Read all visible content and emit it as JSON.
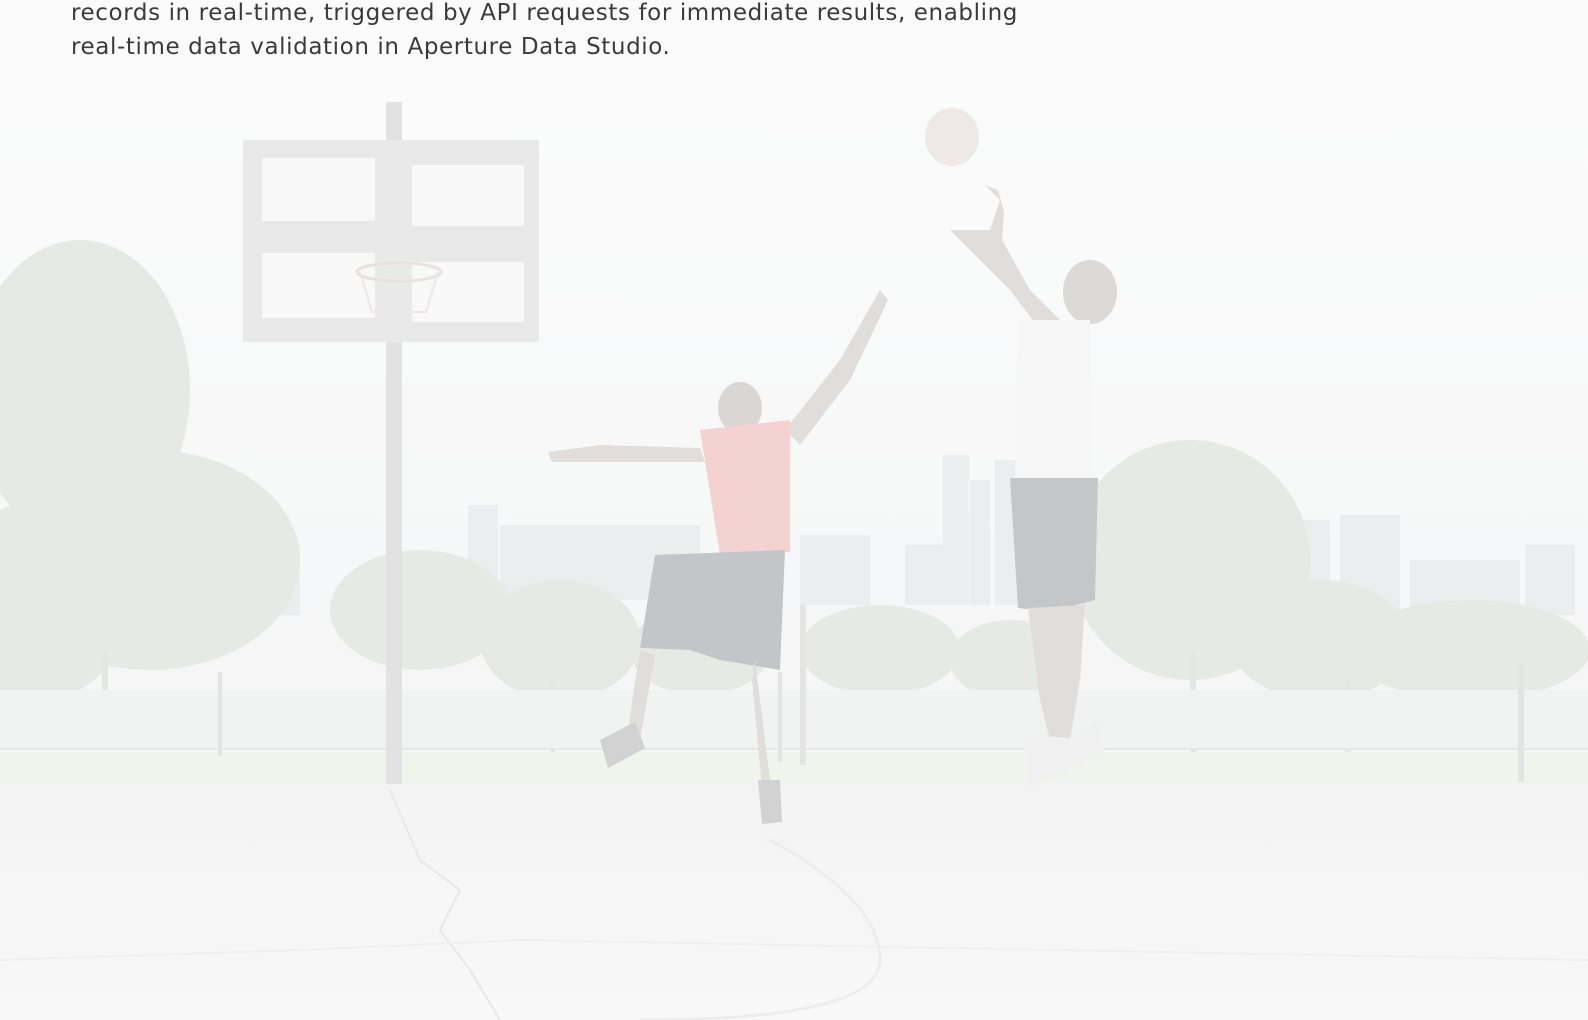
{
  "content": {
    "intro_text": "records in real-time, triggered by API requests for immediate results, enabling real-time data validation in Aperture Data Studio."
  },
  "hero": {
    "subject": "basketball-players-photo",
    "palette": {
      "sky": "#fafafa",
      "trees": "#e3e7e0",
      "buildings": "#e8eaec",
      "court": "#f4f4f4",
      "red_shirt": "#f2c8c8",
      "shorts": "#b5b7bb",
      "skin": "#d9d6d3",
      "ball": "#ece6e4"
    }
  }
}
